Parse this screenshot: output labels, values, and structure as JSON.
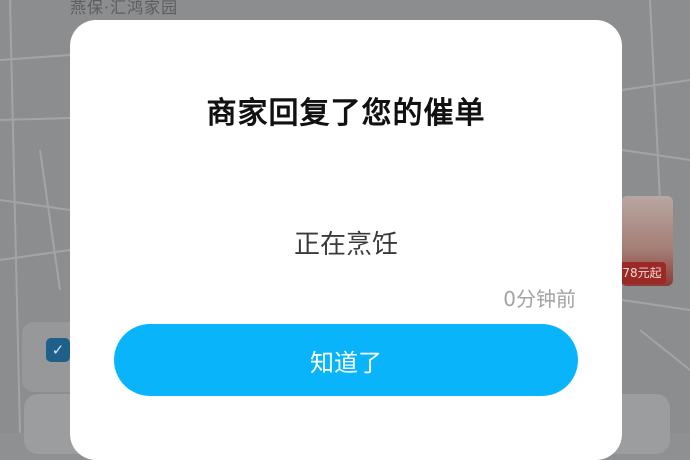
{
  "background": {
    "map_label": "燕保·汇鸿家园",
    "promo_badge": "78元起",
    "check_icon": "checkmark-icon"
  },
  "dialog": {
    "title": "商家回复了您的催单",
    "status": "正在烹饪",
    "time": "0分钟前",
    "confirm_label": "知道了"
  },
  "colors": {
    "accent": "#0AB4FB",
    "overlay": "#8C8D8F",
    "dialog_bg": "#FFFFFF"
  }
}
